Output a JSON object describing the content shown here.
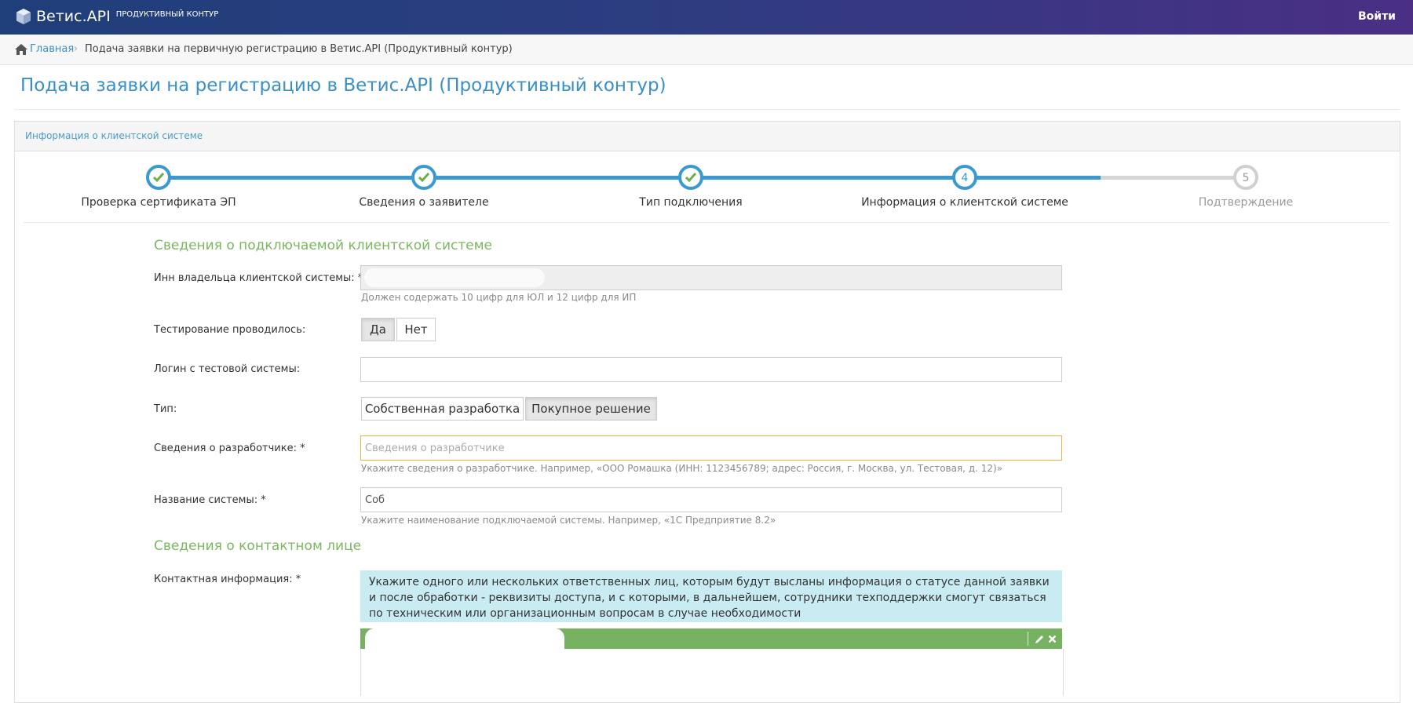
{
  "navbar": {
    "brand_title": "Ветис.API",
    "brand_subtitle": "ПРОДУКТИВНЫЙ КОНТУР",
    "login_label": "Войти"
  },
  "breadcrumb": {
    "home_label": "Главная",
    "separator": "›",
    "current": "Подача заявки на первичную регистрацию в Ветис.API (Продуктивный контур)"
  },
  "page": {
    "title": "Подача заявки на регистрацию в Ветис.API (Продуктивный контур)"
  },
  "panel": {
    "heading": "Информация о клиентской системе"
  },
  "wizard": {
    "current_step": 4,
    "steps": [
      {
        "number": "1",
        "label": "Проверка сертификата ЭП",
        "state": "done"
      },
      {
        "number": "2",
        "label": "Сведения о заявителе",
        "state": "done"
      },
      {
        "number": "3",
        "label": "Тип подключения",
        "state": "done"
      },
      {
        "number": "4",
        "label": "Информация о клиентской системе",
        "state": "active"
      },
      {
        "number": "5",
        "label": "Подтверждение",
        "state": "pending"
      }
    ],
    "colors": {
      "done": "#3a9ad0",
      "pending": "#cccccc",
      "check": "#6bb04a"
    }
  },
  "form": {
    "section_system": "Сведения о подключаемой клиентской системе",
    "inn": {
      "label": "Инн владельца клиентской системы: *",
      "value": "",
      "hint": "Должен содержать 10 цифр для ЮЛ и 12 цифр для ИП"
    },
    "testing": {
      "label": "Тестирование проводилось:",
      "options": [
        "Да",
        "Нет"
      ],
      "selected": "Да"
    },
    "test_login": {
      "label": "Логин с тестовой системы:",
      "value": ""
    },
    "type": {
      "label": "Тип:",
      "options": [
        "Собственная разработка",
        "Покупное решение"
      ],
      "selected": "Покупное решение"
    },
    "developer": {
      "label": "Сведения о разработчике: *",
      "placeholder": "Сведения о разработчике",
      "value": "",
      "hint": "Укажите сведения о разработчике. Например, «ООО Ромашка (ИНН: 1123456789; адрес: Россия, г. Москва, ул. Тестовая, д. 12)»",
      "border_color": "#f0ad4e"
    },
    "system_name": {
      "label": "Название системы: *",
      "value": "Соб",
      "hint": "Укажите наименование подключаемой системы. Например, «1С Предприятие 8.2»"
    },
    "section_contact": "Сведения о контактном лице",
    "contact": {
      "label": "Контактная информация: *",
      "info_text": "Укажите одного или нескольких ответственных лиц, которым будут высланы информация о статусе данной заявки и после обработки - реквизиты доступа, и с которыми, в дальнейшем, сотрудники техподдержки смогут связаться по техническим или организационным вопросам в случае необходимости",
      "edit_icon": "pencil-icon",
      "remove_icon": "close-icon"
    }
  }
}
